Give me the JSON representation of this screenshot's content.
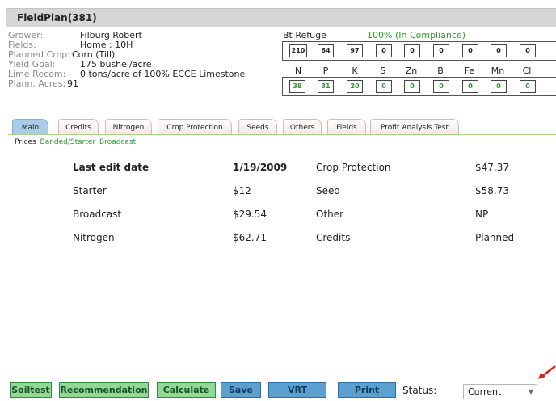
{
  "window": {
    "title": "FieldPlan(381)"
  },
  "info": [
    {
      "label": "Grower:",
      "value": "Filburg Robert"
    },
    {
      "label": "Fields:",
      "value": "Home : 10H"
    },
    {
      "label": "Planned Crop:",
      "value": "Corn (Till)"
    },
    {
      "label": "Yield Goal:",
      "value": "175 bushel/acre"
    },
    {
      "label": "Lime Recom:",
      "value": "0 tons/acre of 100% ECCE Limestone"
    },
    {
      "label": "Plann. Acres:",
      "value": "91"
    }
  ],
  "bt_refuge": {
    "label": "Bt Refuge",
    "compliance": "100% (In Compliance)"
  },
  "top_boxes": [
    "210",
    "64",
    "97",
    "0",
    "0",
    "0",
    "0",
    "0",
    "0"
  ],
  "nutrients": [
    "N",
    "P",
    "K",
    "S",
    "Zn",
    "B",
    "Fe",
    "Mn",
    "Cl"
  ],
  "bottom_boxes": [
    "38",
    "31",
    "20",
    "0",
    "0",
    "0",
    "0",
    "0",
    "0"
  ],
  "tabs": [
    "Main",
    "Credits",
    "Nitrogen",
    "Crop Protection",
    "Seeds",
    "Others",
    "Fields",
    "Profit Analysis Test"
  ],
  "subnav": {
    "current": "Prices",
    "links": [
      "Banded/Starter",
      "Broadcast"
    ]
  },
  "table": [
    {
      "l1": "Last edit date",
      "v1": "1/19/2009",
      "l2": "Crop Protection",
      "v2": "$47.37"
    },
    {
      "l1": "Starter",
      "v1": "$12",
      "l2": "Seed",
      "v2": "$58.73"
    },
    {
      "l1": "Broadcast",
      "v1": "$29.54",
      "l2": "Other",
      "v2": "NP"
    },
    {
      "l1": "Nitrogen",
      "v1": "$62.71",
      "l2": "Credits",
      "v2": "Planned"
    }
  ],
  "buttons": {
    "soiltest": "Soiltest",
    "recommendation": "Recommendation",
    "calculate": "Calculate",
    "save": "Save",
    "vrt": "VRT",
    "print": "Print"
  },
  "status": {
    "label": "Status:",
    "value": "Current"
  },
  "colors": {
    "green_button": "#8fd99a",
    "blue_button": "#5ba0cf",
    "active_tab": "#a9cde8",
    "compliance_green": "#2e9a2e",
    "arrow": "#e02020"
  }
}
